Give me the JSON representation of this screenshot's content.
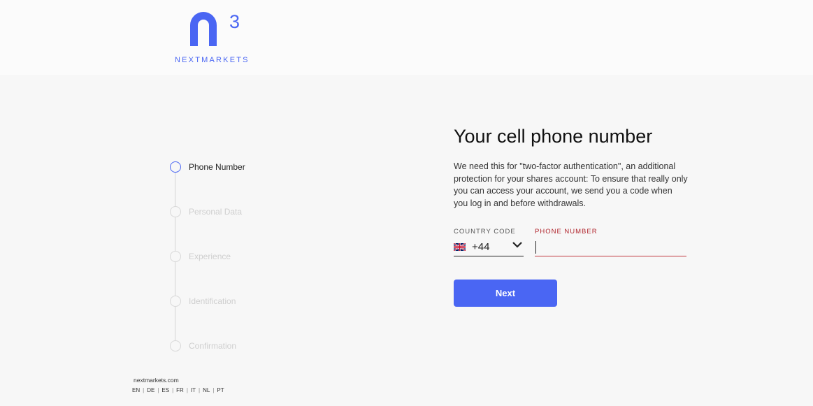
{
  "brand": {
    "name": "NEXTMARKETS",
    "logo_icon": "n3-logo-icon",
    "accent_color": "#4a66f3"
  },
  "steps": [
    {
      "label": "Phone Number",
      "active": true
    },
    {
      "label": "Personal Data",
      "active": false
    },
    {
      "label": "Experience",
      "active": false
    },
    {
      "label": "Identification",
      "active": false
    },
    {
      "label": "Confirmation",
      "active": false
    }
  ],
  "footer": {
    "site": "nextmarkets.com",
    "languages": [
      "EN",
      "DE",
      "ES",
      "FR",
      "IT",
      "NL",
      "PT"
    ]
  },
  "form": {
    "title": "Your cell phone number",
    "description": "We need this for \"two-factor authentication\", an additional protection for your shares account: To ensure that really only you can access your account, we send you a code when you log in and before withdrawals.",
    "country_code_label": "COUNTRY CODE",
    "country_code_value": "+44",
    "country_flag_icon": "uk-flag-icon",
    "phone_label": "PHONE NUMBER",
    "phone_value": "",
    "next_label": "Next",
    "error_color": "#b0232b"
  }
}
